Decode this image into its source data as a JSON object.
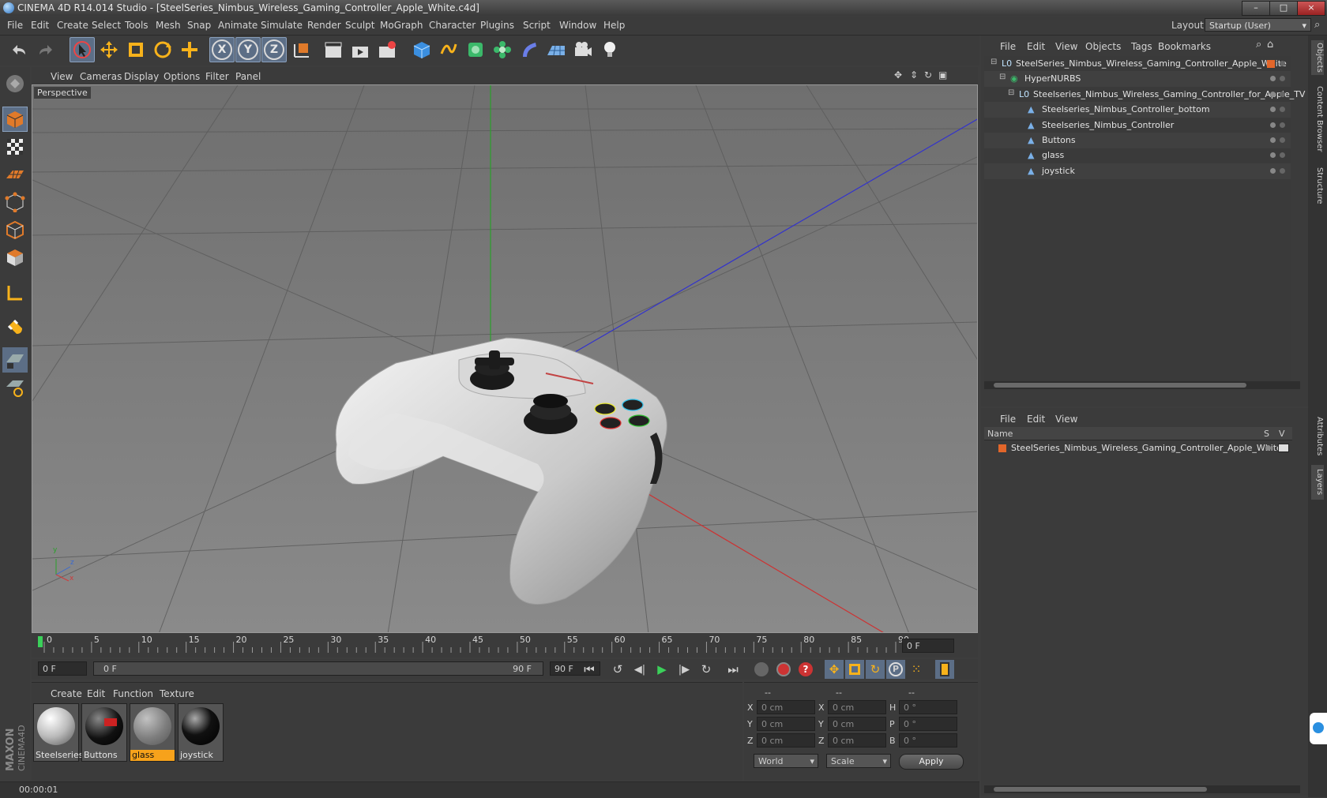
{
  "window": {
    "title": "CINEMA 4D R14.014 Studio - [SteelSeries_Nimbus_Wireless_Gaming_Controller_Apple_White.c4d]",
    "controls": [
      "–",
      "□",
      "×"
    ]
  },
  "menu": [
    "File",
    "Edit",
    "Create",
    "Select",
    "Tools",
    "Mesh",
    "Snap",
    "Animate",
    "Simulate",
    "Render",
    "Sculpt",
    "MoGraph",
    "Character",
    "Plugins",
    "Script",
    "Window",
    "Help"
  ],
  "layout": {
    "label": "Layout:",
    "value": "Startup (User)"
  },
  "toolbar": {
    "axis": [
      "X",
      "Y",
      "Z"
    ]
  },
  "viewport": {
    "menu": [
      "View",
      "Cameras",
      "Display",
      "Options",
      "Filter",
      "Panel"
    ],
    "camera_label": "Perspective",
    "gizmo": {
      "x": "x",
      "y": "y",
      "z": "z"
    }
  },
  "timeline": {
    "ticks": [
      "0",
      "5",
      "10",
      "15",
      "20",
      "25",
      "30",
      "35",
      "40",
      "45",
      "50",
      "55",
      "60",
      "65",
      "70",
      "75",
      "80",
      "85",
      "90"
    ],
    "frame_field": "0 F"
  },
  "playback": {
    "start_field": "0 F",
    "range_start": "0 F",
    "range_end": "90 F",
    "end_field": "90 F"
  },
  "materials": {
    "menu": [
      "Create",
      "Edit",
      "Function",
      "Texture"
    ],
    "items": [
      {
        "label": "Steelseries"
      },
      {
        "label": "Buttons"
      },
      {
        "label": "glass"
      },
      {
        "label": "joystick"
      }
    ]
  },
  "coordinates": {
    "headers": [
      "--",
      "--",
      "--"
    ],
    "rows": [
      {
        "a": "X",
        "av": "0 cm",
        "b": "X",
        "bv": "0 cm",
        "c": "H",
        "cv": "0 °"
      },
      {
        "a": "Y",
        "av": "0 cm",
        "b": "Y",
        "bv": "0 cm",
        "c": "P",
        "cv": "0 °"
      },
      {
        "a": "Z",
        "av": "0 cm",
        "b": "Z",
        "bv": "0 cm",
        "c": "B",
        "cv": "0 °"
      }
    ],
    "world": "World",
    "scale": "Scale",
    "apply": "Apply"
  },
  "status": {
    "time": "00:00:01"
  },
  "objects": {
    "menu": [
      "File",
      "Edit",
      "View",
      "Objects",
      "Tags",
      "Bookmarks"
    ],
    "tree": [
      {
        "label": "SteelSeries_Nimbus_Wireless_Gaming_Controller_Apple_White",
        "depth": 0
      },
      {
        "label": "HyperNURBS",
        "depth": 1
      },
      {
        "label": "Steelseries_Nimbus_Wireless_Gaming_Controller_for_Apple_TV",
        "depth": 2
      },
      {
        "label": "Steelseries_Nimbus_Controller_bottom",
        "depth": 3
      },
      {
        "label": "Steelseries_Nimbus_Controller",
        "depth": 3
      },
      {
        "label": "Buttons",
        "depth": 3
      },
      {
        "label": "glass",
        "depth": 3
      },
      {
        "label": "joystick",
        "depth": 3
      }
    ]
  },
  "layers": {
    "menu": [
      "File",
      "Edit",
      "View"
    ],
    "col_name": "Name",
    "col_s": "S",
    "col_v": "V",
    "rows": [
      {
        "label": "SteelSeries_Nimbus_Wireless_Gaming_Controller_Apple_White"
      }
    ]
  },
  "sidetabs": [
    "Objects",
    "Content Browser",
    "Structure",
    "Attributes",
    "Layers"
  ],
  "colors": {
    "accent": "#f7a21b",
    "selection": "#5c6e86",
    "viewport": "#787878",
    "layer_color": "#e2662a"
  }
}
